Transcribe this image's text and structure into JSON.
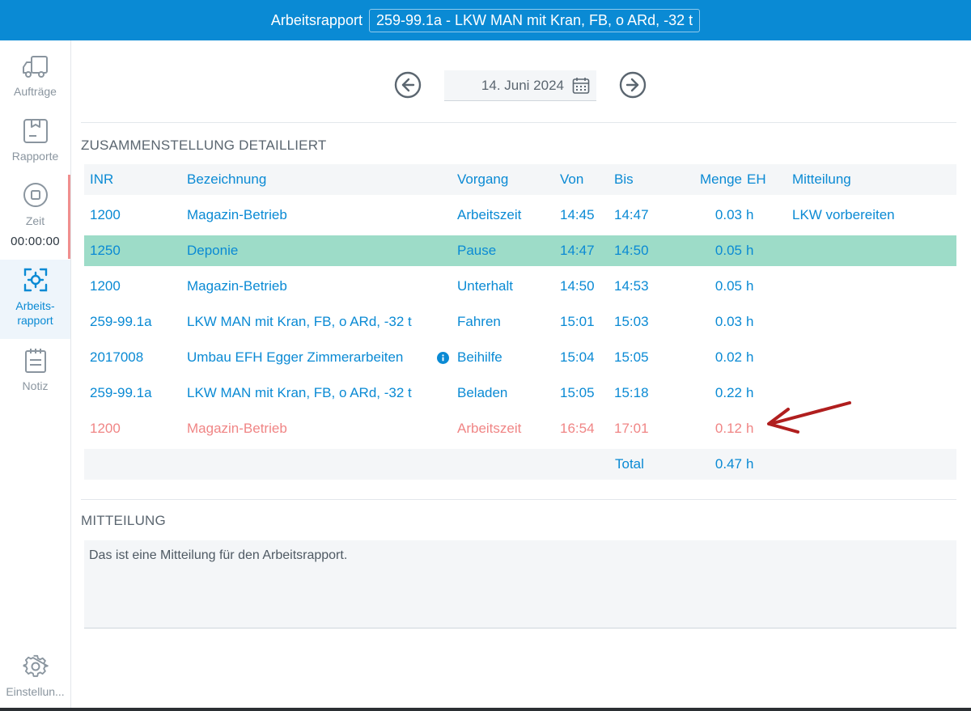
{
  "header": {
    "title": "Arbeitsrapport",
    "vehicle": "259-99.1a - LKW MAN mit Kran, FB, o ARd, -32 t"
  },
  "sidebar": {
    "items": [
      {
        "label": "Aufträge"
      },
      {
        "label": "Rapporte"
      },
      {
        "label": "Zeit",
        "timer": "00:00:00"
      },
      {
        "label": "Arbeits-\nrapport",
        "line1": "Arbeits-",
        "line2": "rapport"
      },
      {
        "label": "Notiz"
      },
      {
        "label": "Einstellun..."
      }
    ]
  },
  "datebar": {
    "date": "14. Juni 2024"
  },
  "summary": {
    "title": "ZUSAMMENSTELLUNG DETAILLIERT",
    "columns": {
      "inr": "INR",
      "bezeichnung": "Bezeichnung",
      "vorgang": "Vorgang",
      "von": "Von",
      "bis": "Bis",
      "menge": "Menge",
      "eh": "EH",
      "mitteilung": "Mitteilung"
    },
    "rows": [
      {
        "inr": "1200",
        "bezeichnung": "Magazin-Betrieb",
        "vorgang": "Arbeitszeit",
        "von": "14:45",
        "bis": "14:47",
        "menge": "0.03",
        "eh": "h",
        "mitteilung": "LKW vorbereiten"
      },
      {
        "inr": "1250",
        "bezeichnung": "Deponie",
        "vorgang": "Pause",
        "von": "14:47",
        "bis": "14:50",
        "menge": "0.05",
        "eh": "h",
        "mitteilung": ""
      },
      {
        "inr": "1200",
        "bezeichnung": "Magazin-Betrieb",
        "vorgang": "Unterhalt",
        "von": "14:50",
        "bis": "14:53",
        "menge": "0.05",
        "eh": "h",
        "mitteilung": ""
      },
      {
        "inr": "259-99.1a",
        "bezeichnung": "LKW MAN mit Kran, FB, o ARd, -32 t",
        "vorgang": "Fahren",
        "von": "15:01",
        "bis": "15:03",
        "menge": "0.03",
        "eh": "h",
        "mitteilung": ""
      },
      {
        "inr": "2017008",
        "bezeichnung": "Umbau EFH Egger Zimmerarbeiten",
        "vorgang": "Beihilfe",
        "von": "15:04",
        "bis": "15:05",
        "menge": "0.02",
        "eh": "h",
        "mitteilung": ""
      },
      {
        "inr": "259-99.1a",
        "bezeichnung": "LKW MAN mit Kran, FB, o ARd, -32 t",
        "vorgang": "Beladen",
        "von": "15:05",
        "bis": "15:18",
        "menge": "0.22",
        "eh": "h",
        "mitteilung": ""
      },
      {
        "inr": "1200",
        "bezeichnung": "Magazin-Betrieb",
        "vorgang": "Arbeitszeit",
        "von": "16:54",
        "bis": "17:01",
        "menge": "0.12",
        "eh": "h",
        "mitteilung": ""
      }
    ],
    "total": {
      "label": "Total",
      "menge": "0.47",
      "eh": "h"
    }
  },
  "message": {
    "title": "MITTEILUNG",
    "text": "Das ist eine Mitteilung für den Arbeitsrapport."
  },
  "colors": {
    "primary": "#0a8ad4",
    "highlight_row": "#9ddcc8",
    "warning_text": "#f08585",
    "annotation_arrow": "#b01e1e"
  }
}
